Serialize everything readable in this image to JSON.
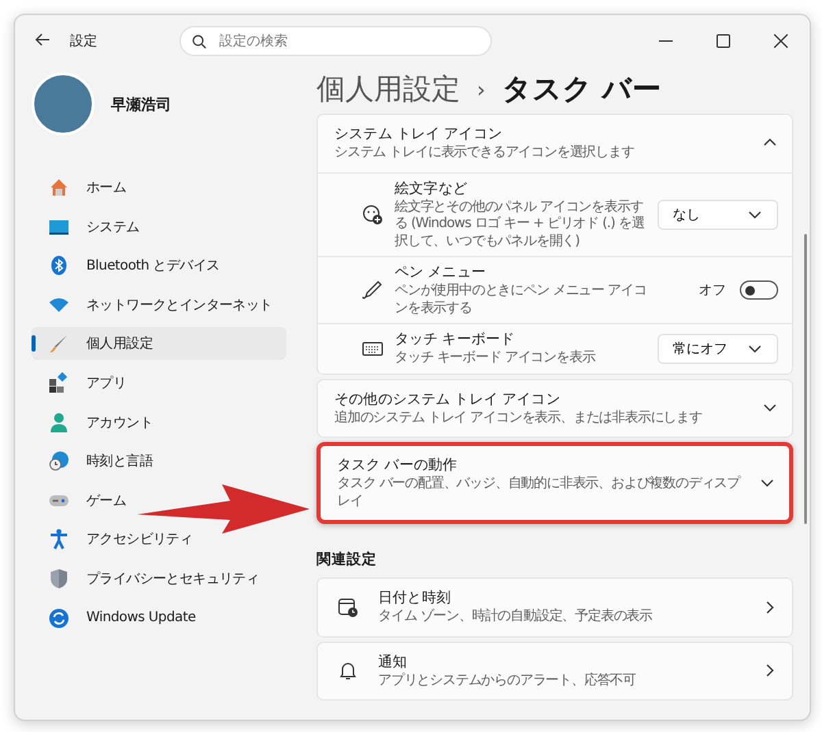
{
  "window": {
    "title": "設定"
  },
  "search": {
    "placeholder": "設定の検索"
  },
  "profile": {
    "name": "早瀬浩司"
  },
  "nav": [
    {
      "label": "ホーム",
      "selected": false
    },
    {
      "label": "システム",
      "selected": false
    },
    {
      "label": "Bluetooth とデバイス",
      "selected": false
    },
    {
      "label": "ネットワークとインターネット",
      "selected": false
    },
    {
      "label": "個人用設定",
      "selected": true
    },
    {
      "label": "アプリ",
      "selected": false
    },
    {
      "label": "アカウント",
      "selected": false
    },
    {
      "label": "時刻と言語",
      "selected": false
    },
    {
      "label": "ゲーム",
      "selected": false
    },
    {
      "label": "アクセシビリティ",
      "selected": false
    },
    {
      "label": "プライバシーとセキュリティ",
      "selected": false
    },
    {
      "label": "Windows Update",
      "selected": false
    }
  ],
  "breadcrumb": {
    "parent": "個人用設定",
    "separator": "›",
    "current": "タスク バー"
  },
  "sections": [
    {
      "title": "システム トレイ アイコン",
      "subtitle": "システム トレイに表示できるアイコンを選択します",
      "expanded": true,
      "highlighted": false,
      "items": [
        {
          "kind": "dropdown",
          "title": "絵文字など",
          "subtitle": "絵文字とその他のパネル アイコンを表示する (Windows ロゴ キー + ピリオド (.) を選択して、いつでもパネルを開く)",
          "value": "なし"
        },
        {
          "kind": "toggle",
          "title": "ペン メニュー",
          "subtitle": "ペンが使用中のときにペン メニュー アイコンを表示する",
          "state_label": "オフ",
          "on": false
        },
        {
          "kind": "dropdown",
          "title": "タッチ キーボード",
          "subtitle": "タッチ キーボード アイコンを表示",
          "value": "常にオフ"
        }
      ]
    },
    {
      "title": "その他のシステム トレイ アイコン",
      "subtitle": "追加のシステム トレイ アイコンを表示、または非表示にします",
      "expanded": false,
      "highlighted": false
    },
    {
      "title": "タスク バーの動作",
      "subtitle": "タスク バーの配置、バッジ、自動的に非表示、および複数のディスプレイ",
      "expanded": false,
      "highlighted": true
    }
  ],
  "related": {
    "heading": "関連設定",
    "links": [
      {
        "title": "日付と時刻",
        "subtitle": "タイム ゾーン、時計の自動設定、予定表の表示"
      },
      {
        "title": "通知",
        "subtitle": "アプリとシステムからのアラート、応答不可"
      }
    ]
  }
}
